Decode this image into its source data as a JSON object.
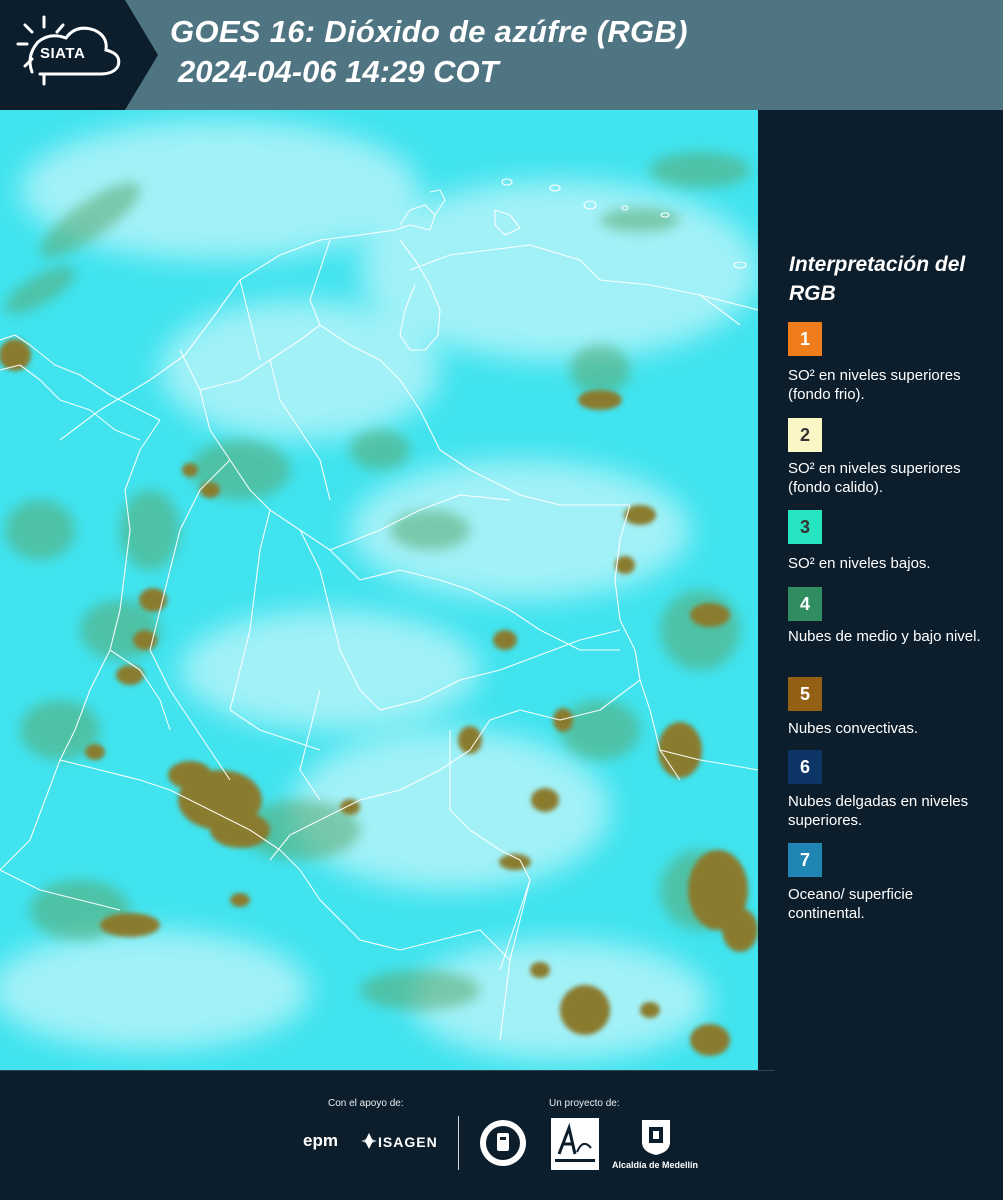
{
  "header": {
    "title_line1": "GOES 16: Dióxido de azúfre (RGB)",
    "title_line2": "2024-04-06 14:29 COT",
    "logo_text": "SIATA"
  },
  "legend": {
    "title": "Interpretación del RGB",
    "items": [
      {
        "number": "1",
        "color": "#f07d1b",
        "text_color": "#ffffff",
        "label": "SO² en niveles superiores (fondo frio)."
      },
      {
        "number": "2",
        "color": "#fbf6c6",
        "text_color": "#333333",
        "label": "SO² en niveles superiores (fondo calido)."
      },
      {
        "number": "3",
        "color": "#27e5c0",
        "text_color": "#333333",
        "label": "SO² en niveles bajos."
      },
      {
        "number": "4",
        "color": "#2f8d60",
        "text_color": "#ffffff",
        "label": "Nubes de medio y bajo nivel."
      },
      {
        "number": "5",
        "color": "#946014",
        "text_color": "#ffffff",
        "label": "Nubes convectivas."
      },
      {
        "number": "6",
        "color": "#0d3566",
        "text_color": "#ffffff",
        "label": "Nubes delgadas en niveles superiores."
      },
      {
        "number": "7",
        "color": "#1f86b3",
        "text_color": "#ffffff",
        "label": "Oceano/ superficie continental."
      }
    ]
  },
  "footer": {
    "support_label": "Con el apoyo de:",
    "project_label": "Un proyecto de:",
    "sponsor_1": "epm",
    "sponsor_2": "ISAGEN",
    "partner_label": "Alcaldía de Medellín"
  },
  "map_colors": {
    "background": "#3fe4ee",
    "haze": "#bff6fb",
    "convective": "#8a7a2c",
    "green_texture": "#5caa72",
    "borders": "#ffffff"
  }
}
